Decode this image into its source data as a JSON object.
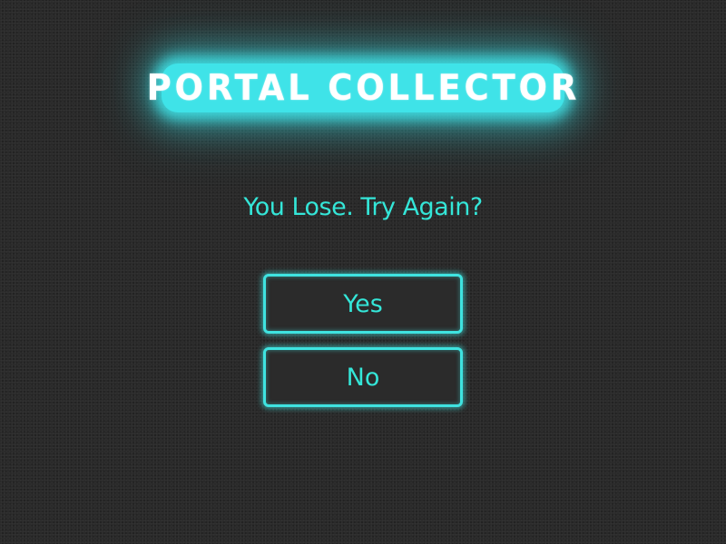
{
  "game": {
    "title": "PORTAL COLLECTOR",
    "prompt": "You Lose. Try Again?"
  },
  "buttons": {
    "yes_label": "Yes",
    "no_label": "No"
  },
  "colors": {
    "background": "#2a2a2a",
    "accent": "#34e6d8",
    "title_glow": "#3fe3e8",
    "title_text": "#ffffff",
    "button_fill": "#2b2b2b"
  }
}
